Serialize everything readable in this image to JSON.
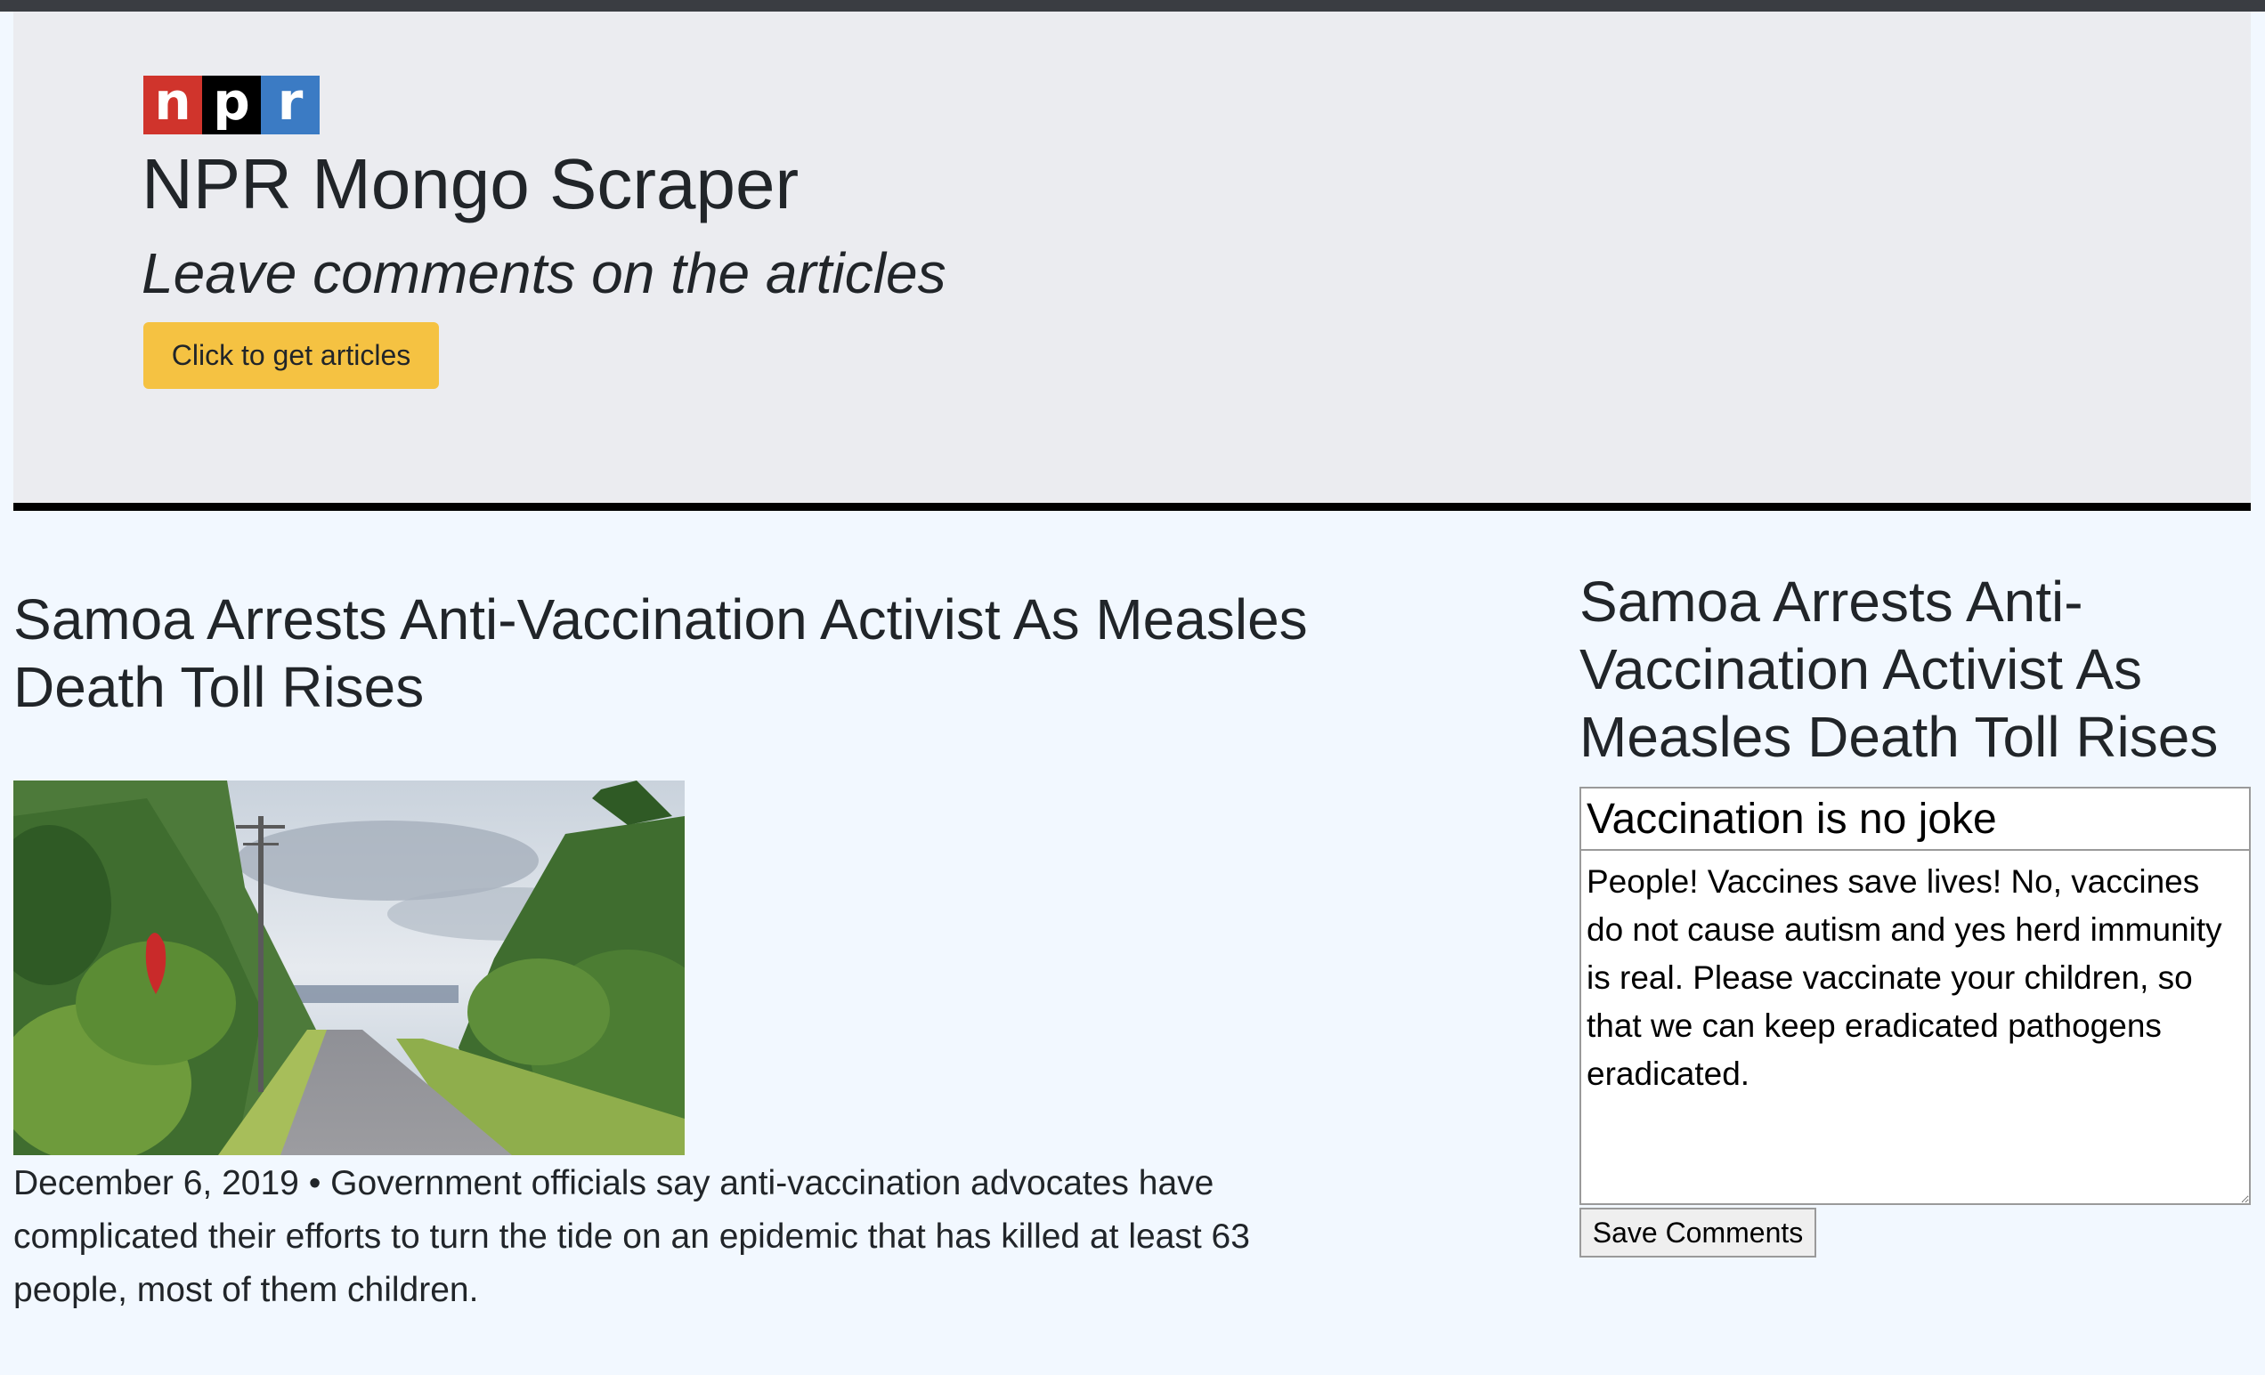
{
  "logo": {
    "letters": [
      "n",
      "p",
      "r"
    ],
    "colors": [
      "#d0342c",
      "#000000",
      "#3b7bc4"
    ]
  },
  "header": {
    "title": "NPR Mongo Scraper",
    "tagline": "Leave comments on the articles",
    "get_articles_label": "Click to get articles",
    "button_color": "#f5c242"
  },
  "article": {
    "title": "Samoa Arrests Anti-Vaccination Activist As Measles Death Toll Rises",
    "image_icon": "road-photo",
    "summary": "December 6, 2019 • Government officials say anti-vaccination advocates have complicated their efforts to turn the tide on an epidemic that has killed at least 63 people, most of them children."
  },
  "comments": {
    "article_title": "Samoa Arrests Anti-Vaccination Activist As Measles Death Toll Rises",
    "title_value": "Vaccination is no joke",
    "body_value": "People! Vaccines save lives! No, vaccines do not cause autism and yes herd immunity is real. Please vaccinate your children, so that we can keep eradicated pathogens eradicated.",
    "save_label": "Save Comments"
  }
}
